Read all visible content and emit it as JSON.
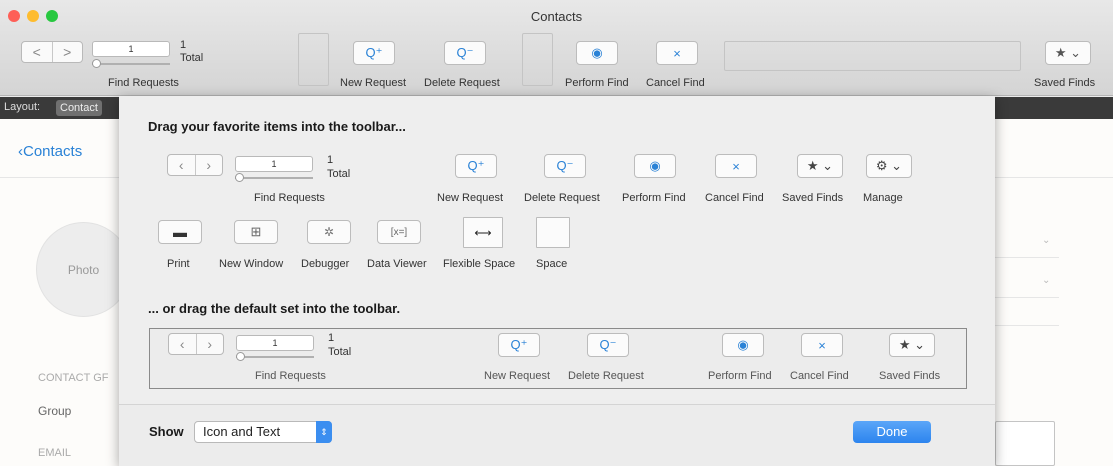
{
  "window": {
    "title": "Contacts",
    "colors": {
      "close": "#fe5f57",
      "minimize": "#febc2e",
      "zoom": "#28c840",
      "accent": "#2a82d6"
    }
  },
  "toolbar": {
    "nav_prev": "<",
    "nav_next": ">",
    "record_value": "1",
    "record_count": "1",
    "record_total": "Total",
    "find_requests_label": "Find Requests",
    "new_request_label": "New Request",
    "delete_request_label": "Delete Request",
    "perform_find_label": "Perform Find",
    "cancel_find_label": "Cancel Find",
    "saved_finds_label": "Saved Finds"
  },
  "layout_bar": {
    "label": "Layout:",
    "value": "Contact"
  },
  "background": {
    "back_link": "Contacts",
    "photo_label": "Photo",
    "contact_group_label": "CONTACT GF",
    "group_label": "Group",
    "email_label": "EMAIL"
  },
  "sheet": {
    "heading_favorites": "Drag your favorite items into the toolbar...",
    "heading_default": "... or drag the default set into the toolbar.",
    "items": {
      "find_requests": "Find Requests",
      "total": "Total",
      "record_value": "1",
      "record_count": "1",
      "new_request": "New Request",
      "delete_request": "Delete Request",
      "perform_find": "Perform Find",
      "cancel_find": "Cancel Find",
      "saved_finds": "Saved Finds",
      "manage": "Manage",
      "print": "Print",
      "new_window": "New Window",
      "debugger": "Debugger",
      "data_viewer": "Data Viewer",
      "flexible_space": "Flexible Space",
      "space": "Space"
    },
    "default_set": {
      "find_requests": "Find Requests",
      "total": "Total",
      "record_value": "1",
      "record_count": "1",
      "new_request": "New Request",
      "delete_request": "Delete Request",
      "perform_find": "Perform Find",
      "cancel_find": "Cancel Find",
      "saved_finds": "Saved Finds"
    },
    "show_label": "Show",
    "show_value": "Icon and Text",
    "done_label": "Done"
  }
}
